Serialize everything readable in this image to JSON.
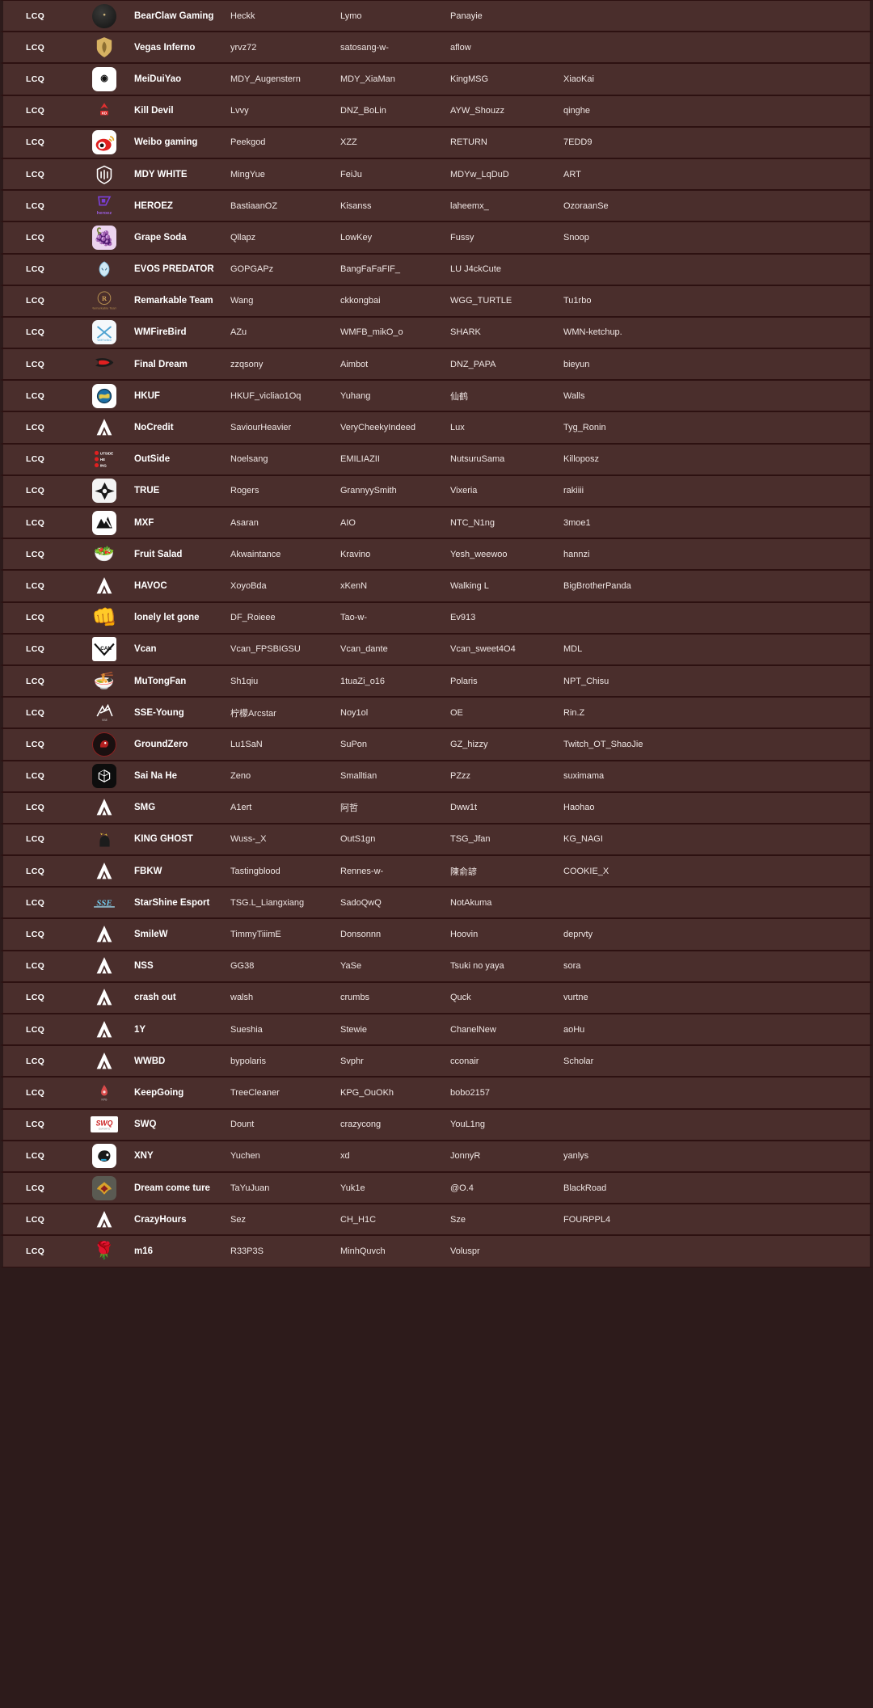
{
  "table": {
    "columns": [
      "stage",
      "logo",
      "team",
      "player1",
      "player2",
      "player3",
      "player4"
    ],
    "stage_label": "LCQ",
    "rows": [
      {
        "stage": "LCQ",
        "team": "BearClaw Gaming",
        "logo": "bearclaw-logo-icon",
        "p1": "Heckk",
        "p2": "Lymo",
        "p3": "Panayie",
        "p4": ""
      },
      {
        "stage": "LCQ",
        "team": "Vegas Inferno",
        "logo": "vegas-inferno-shield-icon",
        "p1": "yrvz72",
        "p2": "satosang-w-",
        "p3": "aflow",
        "p4": ""
      },
      {
        "stage": "LCQ",
        "team": "MeiDuiYao",
        "logo": "meiduiyao-logo-icon",
        "p1": "MDY_Augenstern",
        "p2": "MDY_XiaMan",
        "p3": "KingMSG",
        "p4": "XiaoKai"
      },
      {
        "stage": "LCQ",
        "team": "Kill Devil",
        "logo": "kill-devil-logo-icon",
        "p1": "Lvvy",
        "p2": "DNZ_BoLin",
        "p3": "AYW_Shouzz",
        "p4": "qinghe"
      },
      {
        "stage": "LCQ",
        "team": "Weibo gaming",
        "logo": "weibo-eye-icon",
        "p1": "Peekgod",
        "p2": "XZZ",
        "p3": "RETURN",
        "p4": "7EDD9"
      },
      {
        "stage": "LCQ",
        "team": "MDY WHITE",
        "logo": "mdy-white-logo-icon",
        "p1": "MingYue",
        "p2": "FeiJu",
        "p3": "MDYw_LqDuD",
        "p4": "ART"
      },
      {
        "stage": "LCQ",
        "team": "HEROEZ",
        "logo": "heroez-logo-icon",
        "p1": "BastiaanOZ",
        "p2": "Kisanss",
        "p3": "laheemx_",
        "p4": "OzoraanSe"
      },
      {
        "stage": "LCQ",
        "team": "Grape Soda",
        "logo": "grape-soda-icon",
        "p1": "Qllapz",
        "p2": "LowKey",
        "p3": "Fussy",
        "p4": "Snoop"
      },
      {
        "stage": "LCQ",
        "team": "EVOS PREDATOR",
        "logo": "evos-predator-icon",
        "p1": "GOPGAPz",
        "p2": "BangFaFaFIF_",
        "p3": "LU J4ckCute",
        "p4": ""
      },
      {
        "stage": "LCQ",
        "team": "Remarkable Team",
        "logo": "remarkable-team-icon",
        "p1": "Wang",
        "p2": "ckkongbai",
        "p3": "WGG_TURTLE",
        "p4": "Tu1rbo"
      },
      {
        "stage": "LCQ",
        "team": "WMFireBird",
        "logo": "wmfirebird-icon",
        "p1": "AZu",
        "p2": "WMFB_mikO_o",
        "p3": "SHARK",
        "p4": "WMN-ketchup."
      },
      {
        "stage": "LCQ",
        "team": "Final Dream",
        "logo": "final-dream-icon",
        "p1": "zzqsony",
        "p2": "Aimbot",
        "p3": "DNZ_PAPA",
        "p4": "bieyun"
      },
      {
        "stage": "LCQ",
        "team": "HKUF",
        "logo": "hkuf-globe-icon",
        "p1": "HKUF_vicliao1Oq",
        "p2": "Yuhang",
        "p3": "仙鹤",
        "p4": "Walls"
      },
      {
        "stage": "LCQ",
        "team": "NoCredit",
        "logo": "apex-legends-icon",
        "p1": "SaviourHeavier",
        "p2": "VeryCheekyIndeed",
        "p3": "Lux",
        "p4": "Tyg_Ronin"
      },
      {
        "stage": "LCQ",
        "team": "OutSide",
        "logo": "outside-the-ring-icon",
        "p1": "Noelsang",
        "p2": "EMILIAZII",
        "p3": "NutsuruSama",
        "p4": "Killoposz"
      },
      {
        "stage": "LCQ",
        "team": "TRUE",
        "logo": "true-star-icon",
        "p1": "Rogers",
        "p2": "GrannyySmith",
        "p3": "Vixeria",
        "p4": "rakiiii"
      },
      {
        "stage": "LCQ",
        "team": "MXF",
        "logo": "mxf-mountain-icon",
        "p1": "Asaran",
        "p2": "AIO",
        "p3": "NTC_N1ng",
        "p4": "3moe1"
      },
      {
        "stage": "LCQ",
        "team": "Fruit Salad",
        "logo": "fruit-salad-icon",
        "p1": "Akwaintance",
        "p2": "Kravino",
        "p3": "Yesh_weewoo",
        "p4": "hannzi"
      },
      {
        "stage": "LCQ",
        "team": "HAVOC",
        "logo": "apex-legends-icon",
        "p1": "XoyoBda",
        "p2": "xKenN",
        "p3": "Walking L",
        "p4": "BigBrotherPanda"
      },
      {
        "stage": "LCQ",
        "team": "lonely let gone",
        "logo": "fist-icon",
        "p1": "DF_Roieee",
        "p2": "Tao-w-",
        "p3": "Ev913",
        "p4": ""
      },
      {
        "stage": "LCQ",
        "team": "Vcan",
        "logo": "vcan-logo-icon",
        "p1": "Vcan_FPSBIGSU",
        "p2": "Vcan_dante",
        "p3": "Vcan_sweet4O4",
        "p4": "MDL"
      },
      {
        "stage": "LCQ",
        "team": "MuTongFan",
        "logo": "mutongfan-icon",
        "p1": "Sh1qiu",
        "p2": "1tuaZi_o16",
        "p3": "Polaris",
        "p4": "NPT_Chisu"
      },
      {
        "stage": "LCQ",
        "team": "SSE-Young",
        "logo": "sse-young-icon",
        "p1": "柠檬Arcstar",
        "p2": "Noy1ol",
        "p3": "OE",
        "p4": "Rin.Z"
      },
      {
        "stage": "LCQ",
        "team": "GroundZero",
        "logo": "groundzero-icon",
        "p1": "Lu1SaN",
        "p2": "SuPon",
        "p3": "GZ_hizzy",
        "p4": "Twitch_OT_ShaoJie"
      },
      {
        "stage": "LCQ",
        "team": "Sai Na He",
        "logo": "sai-na-he-icon",
        "p1": "Zeno",
        "p2": "Smalltian",
        "p3": "PZzz",
        "p4": "suximama"
      },
      {
        "stage": "LCQ",
        "team": "SMG",
        "logo": "apex-legends-icon",
        "p1": "A1ert",
        "p2": "阿哲",
        "p3": "Dww1t",
        "p4": "Haohao"
      },
      {
        "stage": "LCQ",
        "team": "KING GHOST",
        "logo": "king-ghost-icon",
        "p1": "Wuss-_X",
        "p2": "OutS1gn",
        "p3": "TSG_Jfan",
        "p4": "KG_NAGI"
      },
      {
        "stage": "LCQ",
        "team": "FBKW",
        "logo": "apex-legends-icon",
        "p1": "Tastingblood",
        "p2": "Rennes-w-",
        "p3": "陳俞諺",
        "p4": "COOKIE_X"
      },
      {
        "stage": "LCQ",
        "team": "StarShine Esport",
        "logo": "starshine-esport-icon",
        "p1": "TSG.L_Liangxiang",
        "p2": "SadoQwQ",
        "p3": "NotAkuma",
        "p4": ""
      },
      {
        "stage": "LCQ",
        "team": "SmileW",
        "logo": "apex-legends-icon",
        "p1": "TimmyTiiimE",
        "p2": "Donsonnn",
        "p3": "Hoovin",
        "p4": "deprvty"
      },
      {
        "stage": "LCQ",
        "team": "NSS",
        "logo": "apex-legends-icon",
        "p1": "GG38",
        "p2": "YaSe",
        "p3": "Tsuki no yaya",
        "p4": "sora"
      },
      {
        "stage": "LCQ",
        "team": "crash out",
        "logo": "apex-legends-icon",
        "p1": "walsh",
        "p2": "crumbs",
        "p3": "Quck",
        "p4": "vurtne"
      },
      {
        "stage": "LCQ",
        "team": "1Y",
        "logo": "apex-legends-icon",
        "p1": "Sueshia",
        "p2": "Stewie",
        "p3": "ChanelNew",
        "p4": "aoHu"
      },
      {
        "stage": "LCQ",
        "team": "WWBD",
        "logo": "apex-legends-icon",
        "p1": "bypolaris",
        "p2": "Svphr",
        "p3": "cconair",
        "p4": "Scholar"
      },
      {
        "stage": "LCQ",
        "team": "KeepGoing",
        "logo": "keepgoing-icon",
        "p1": "TreeCleaner",
        "p2": "KPG_OuOKh",
        "p3": "bobo2157",
        "p4": ""
      },
      {
        "stage": "LCQ",
        "team": "SWQ",
        "logo": "swq-logo-icon",
        "p1": "Dount",
        "p2": "crazycong",
        "p3": "YouL1ng",
        "p4": ""
      },
      {
        "stage": "LCQ",
        "team": "XNY",
        "logo": "xny-dragon-icon",
        "p1": "Yuchen",
        "p2": "xd",
        "p3": "JonnyR",
        "p4": "yanlys"
      },
      {
        "stage": "LCQ",
        "team": "Dream come ture",
        "logo": "dream-come-ture-icon",
        "p1": "TaYuJuan",
        "p2": "Yuk1e",
        "p3": "@O.4",
        "p4": "BlackRoad"
      },
      {
        "stage": "LCQ",
        "team": "CrazyHours",
        "logo": "apex-legends-icon",
        "p1": "Sez",
        "p2": "CH_H1C",
        "p3": "Sze",
        "p4": "FOURPPL4"
      },
      {
        "stage": "LCQ",
        "team": "m16",
        "logo": "m16-rose-icon",
        "p1": "R33P3S",
        "p2": "MinhQuvch",
        "p3": "Voluspr",
        "p4": ""
      }
    ]
  },
  "colors": {
    "page_background": "#2d1b1b",
    "row_background": "#4a2e2c",
    "row_divider": "#2d1111",
    "team_text": "#ffffff",
    "player_text": "#efe6e4"
  }
}
